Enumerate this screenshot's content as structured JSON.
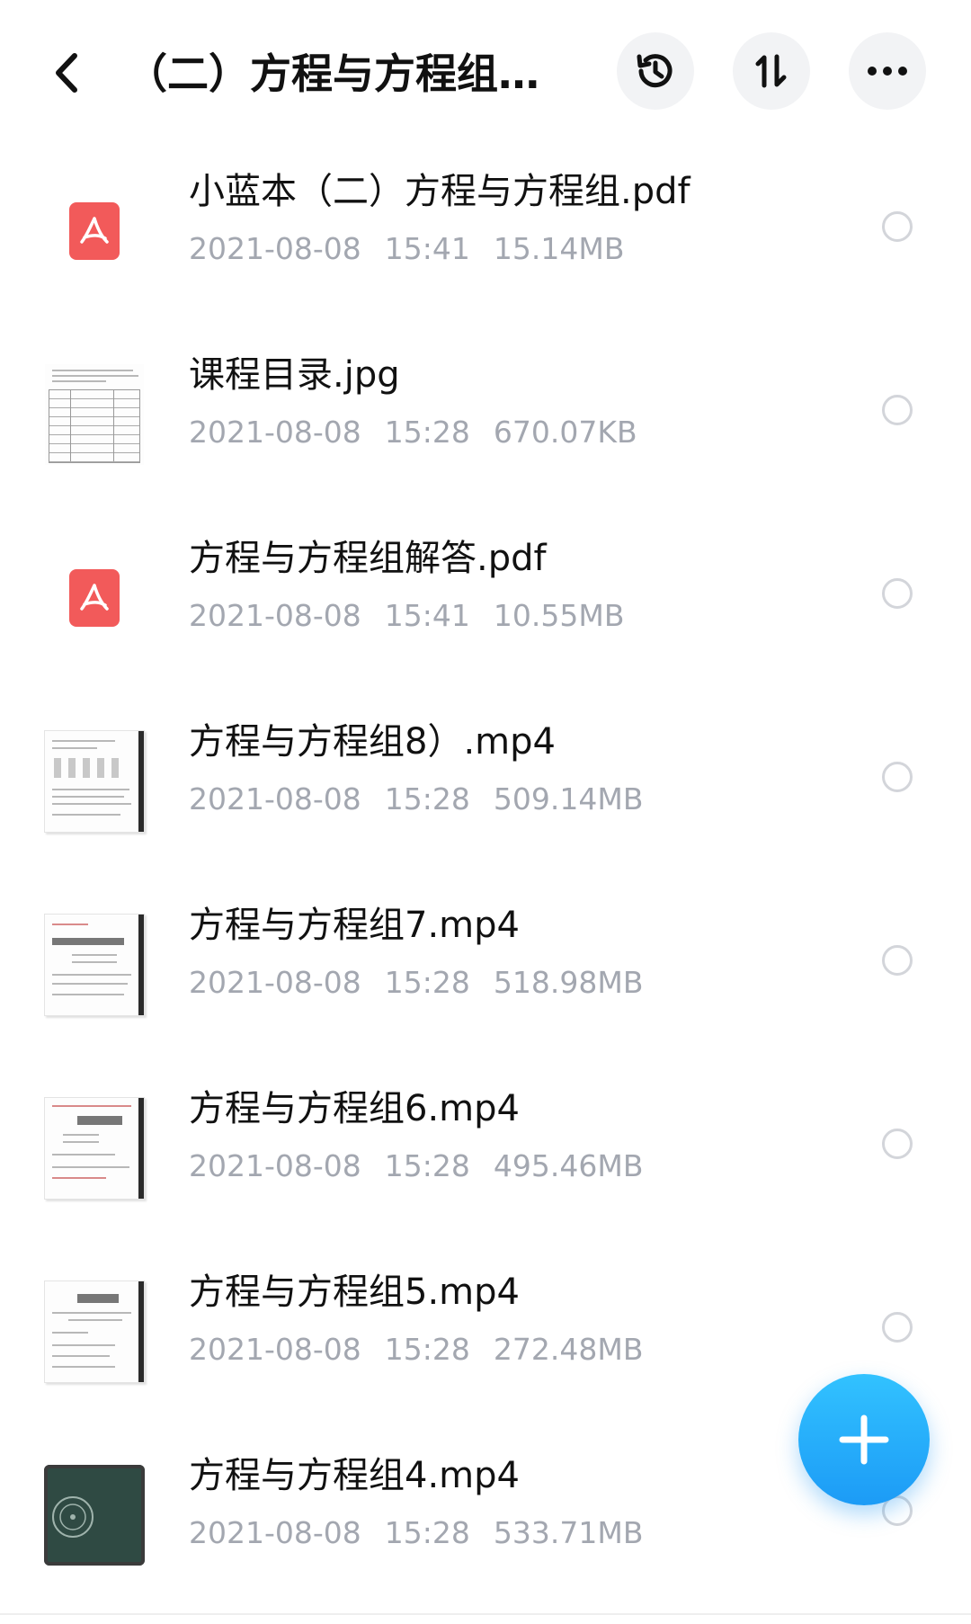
{
  "header": {
    "title": "（二）方程与方程组...",
    "icons": {
      "back": "chevron-left-icon",
      "history": "history-icon",
      "sort": "sort-icon",
      "more": "more-icon"
    }
  },
  "files": [
    {
      "name": "小蓝本（二）方程与方程组.pdf",
      "date": "2021-08-08",
      "time": "15:41",
      "size": "15.14MB",
      "thumb": "pdf"
    },
    {
      "name": "课程目录.jpg",
      "date": "2021-08-08",
      "time": "15:28",
      "size": "670.07KB",
      "thumb": "doc"
    },
    {
      "name": "方程与方程组解答.pdf",
      "date": "2021-08-08",
      "time": "15:41",
      "size": "10.55MB",
      "thumb": "pdf"
    },
    {
      "name": "方程与方程组8）.mp4",
      "date": "2021-08-08",
      "time": "15:28",
      "size": "509.14MB",
      "thumb": "doc"
    },
    {
      "name": "方程与方程组7.mp4",
      "date": "2021-08-08",
      "time": "15:28",
      "size": "518.98MB",
      "thumb": "doc"
    },
    {
      "name": "方程与方程组6.mp4",
      "date": "2021-08-08",
      "time": "15:28",
      "size": "495.46MB",
      "thumb": "doc"
    },
    {
      "name": "方程与方程组5.mp4",
      "date": "2021-08-08",
      "time": "15:28",
      "size": "272.48MB",
      "thumb": "doc"
    },
    {
      "name": "方程与方程组4.mp4",
      "date": "2021-08-08",
      "time": "15:28",
      "size": "533.71MB",
      "thumb": "chalkboard"
    }
  ],
  "fab": {
    "icon": "plus-icon"
  },
  "colors": {
    "accent": "#1c9bf6",
    "pdf": "#f25a5a",
    "meta": "#a3a7b0"
  }
}
